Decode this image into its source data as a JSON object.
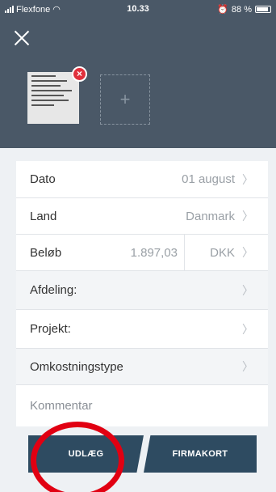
{
  "status_bar": {
    "carrier": "Flexfone",
    "time": "10.33",
    "battery": "88 %",
    "battery_level": 0.88
  },
  "header": {
    "close_icon": "close-icon",
    "remove_icon": "remove-icon",
    "add_icon": "plus-icon"
  },
  "form": {
    "date": {
      "label": "Dato",
      "value": "01 august"
    },
    "country": {
      "label": "Land",
      "value": "Danmark"
    },
    "amount": {
      "label": "Beløb",
      "value": "1.897,03",
      "currency": "DKK"
    },
    "department": {
      "label": "Afdeling:"
    },
    "project": {
      "label": "Projekt:"
    },
    "expense_type": {
      "label": "Omkostningstype"
    },
    "comment": {
      "label": "Kommentar"
    }
  },
  "buttons": {
    "udlaeg": "UDLÆG",
    "firmakort": "FIRMAKORT"
  },
  "colors": {
    "header": "#4a5867",
    "button": "#2e4b61",
    "annotation": "#e10012",
    "badge": "#e0303c"
  }
}
